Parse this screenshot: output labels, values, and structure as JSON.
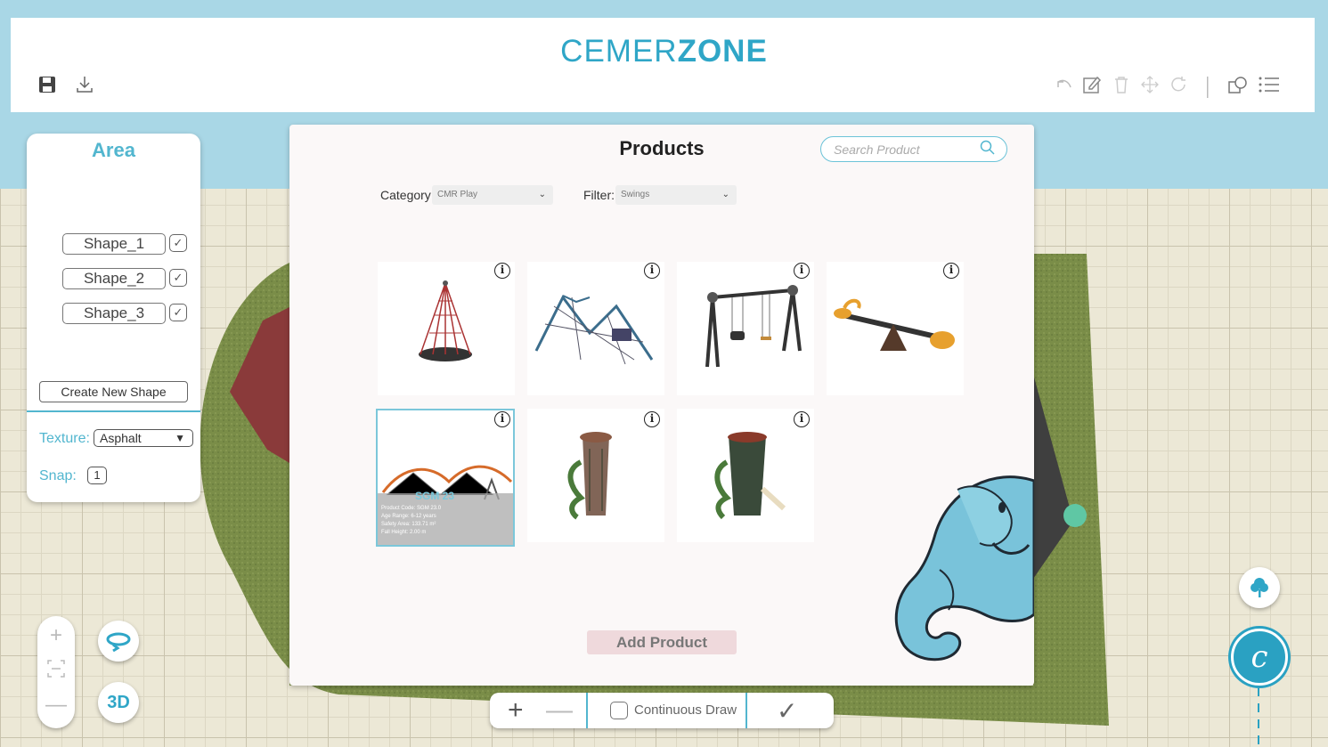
{
  "header": {
    "logo_light": "CEMER",
    "logo_bold": "ZONE",
    "left_icons": [
      "save-icon",
      "download-icon"
    ],
    "right_icons": [
      "undo-icon",
      "edit-icon",
      "trash-icon",
      "move-icon",
      "rotate-icon",
      "layers-icon",
      "list-icon"
    ]
  },
  "area": {
    "title": "Area",
    "shapes": [
      {
        "label": "Shape_1",
        "checked": true
      },
      {
        "label": "Shape_2",
        "checked": true
      },
      {
        "label": "Shape_3",
        "checked": true
      }
    ],
    "create_button": "Create New Shape",
    "texture_label": "Texture:",
    "texture_value": "Asphalt",
    "snap_label": "Snap:",
    "snap_value": "1"
  },
  "products": {
    "title": "Products",
    "search_placeholder": "Search Product",
    "category_label": "Category:",
    "category_value": "CMR Play",
    "filter_label": "Filter:",
    "filter_value": "Swings",
    "items": [
      {
        "name": "cone-net-swing",
        "info": "i"
      },
      {
        "name": "net-climbing-structure",
        "info": "i"
      },
      {
        "name": "double-swing",
        "info": "i"
      },
      {
        "name": "seesaw",
        "info": "i"
      },
      {
        "name": "rope-bridge-structure",
        "info": "i",
        "selected": true
      },
      {
        "name": "tower-slide-1",
        "info": "i"
      },
      {
        "name": "tower-slide-2",
        "info": "i"
      }
    ],
    "selected_overlay": {
      "title": "SGM 23",
      "lines": [
        "Product Code: SGM 23.0",
        "Age Range: 6-12 years",
        "Safety Area: 133.71 m²",
        "Fall Height: 2.00 m"
      ]
    },
    "add_button": "Add Product"
  },
  "bottom_bar": {
    "plus": "+",
    "minus": "—",
    "continuous_label": "Continuous Draw",
    "confirm": "✓"
  },
  "view_controls": {
    "zoom_in": "+",
    "fit": "⌗",
    "zoom_out": "—",
    "rotate_icon": "rotate-view-icon",
    "mode_3d": "3D"
  },
  "colors": {
    "accent": "#2fa6c7",
    "grass": "#7c8f4a",
    "header_frame": "#a9d7e6"
  }
}
